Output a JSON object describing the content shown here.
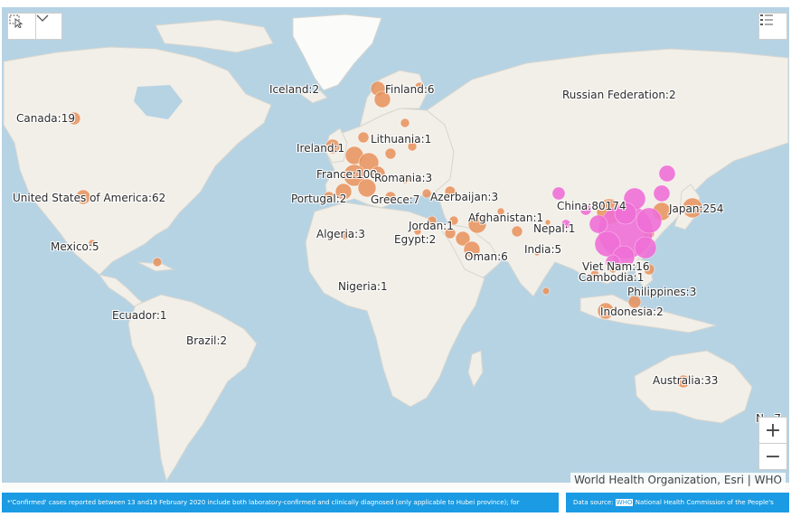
{
  "colors": {
    "ocean": "#b6d3e4",
    "land": "#f2efe8",
    "ice": "#fbfbfa",
    "case_marker": "#e8915a",
    "china_marker": "#ee6fd6",
    "footer_bg": "#1a9be3"
  },
  "toolbar": {
    "select_icon": "select-cursor-icon",
    "dropdown_icon": "chevron-down-icon",
    "legend_icon": "legend-list-icon"
  },
  "labels": {
    "iceland": "Iceland:2",
    "finland": "Finland:6",
    "russia": "Russian Federation:2",
    "canada": "Canada:19",
    "lithuania": "Lithuania:1",
    "ireland": "Ireland:1",
    "france": "France:100",
    "romania": "Romania:3",
    "usa": "United States of America:62",
    "portugal": "Portugal:2",
    "greece": "Greece:7",
    "azerbaijan": "Azerbaijan:3",
    "china": "China:80174",
    "japan": "Japan:254",
    "afghanistan": "Afghanistan:1",
    "jordan": "Jordan:1",
    "mexico": "Mexico:5",
    "algeria": "Algeria:3",
    "egypt": "Egypt:2",
    "nepal": "Nepal:1",
    "india": "India:5",
    "oman": "Oman:6",
    "vietnam": "Viet Nam:16",
    "cambodia": "Cambodia:1",
    "nigeria": "Nigeria:1",
    "philippines": "Philippines:3",
    "ecuador": "Ecuador:1",
    "indonesia": "Indonesia:2",
    "brazil": "Brazil:2",
    "australia": "Australia:33",
    "nz_partial": "N...7"
  },
  "zoom": {
    "in": "+",
    "out": "−"
  },
  "attribution": "World Health Organization, Esri | WHO",
  "footer": {
    "note": "*'Confirmed' cases reported between 13 and19 February 2020 include both laboratory-confirmed and clinically diagnosed (only  applicable to Hubei province); for",
    "source_prefix": "Data source:",
    "source_who": "WHO",
    "source_rest": "National Health Commission of the People's"
  }
}
